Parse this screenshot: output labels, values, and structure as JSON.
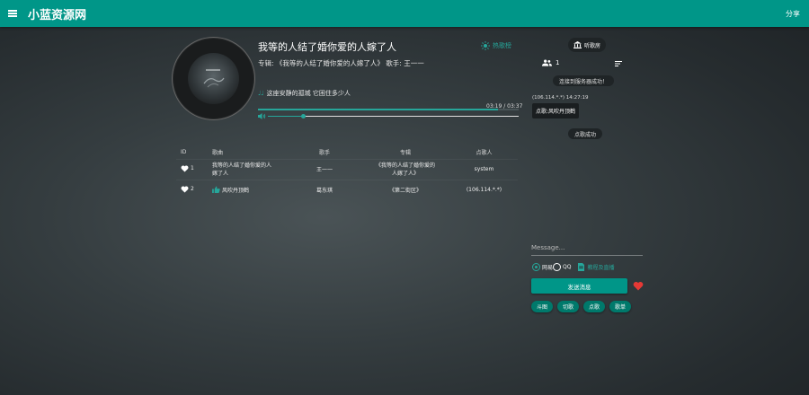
{
  "header": {
    "app_title": "小蓝资源网",
    "share_label": "分享",
    "menu_icon": "menu-icon",
    "bar_color": "#009688"
  },
  "player": {
    "title": "我等的人结了婚你爱的人嫁了人",
    "album_line": "专辑: 《我等的人结了婚你爱的人嫁了人》 歌手: 王一一",
    "hot_songs_label": "热歌榜",
    "lyric": "这座安静的孤城 它困住多少人",
    "time": "03:19 / 03:37",
    "progress": 0.92,
    "volume": 0.14,
    "accent": "#26a69a"
  },
  "playlist": {
    "headers": {
      "id": "ID",
      "song": "歌曲",
      "singer": "歌手",
      "album": "专辑",
      "requester": "点歌人"
    },
    "rows": [
      {
        "id": "1",
        "song_line1": "我等的人结了婚你爱的人",
        "song_line2": "嫁了人",
        "singer": "王一一",
        "album_line1": "《我等的人结了婚你爱的",
        "album_line2": "人嫁了人》",
        "requester": "system"
      },
      {
        "id": "2",
        "song": "风吹丹顶鹤",
        "singer": "葛东琪",
        "album": "《第二街区》",
        "requester": "(106.114.*.*)"
      }
    ]
  },
  "sidebar": {
    "room_label": "听歌房",
    "online_count": "1",
    "connect_status": "连接到服务器成功！",
    "chat_meta": "(106.114.*.*) 14:27:19",
    "chat_message": "点歌:风吹丹顶鹤",
    "request_success": "点歌成功"
  },
  "composer": {
    "placeholder": "Message...",
    "radio_netease": "网易",
    "radio_qq": "QQ",
    "tutorial_link": "教程及直播",
    "send_label": "发送消息",
    "chips": [
      "斗图",
      "切歌",
      "点歌",
      "歌单"
    ],
    "heart_color": "#e53935"
  }
}
